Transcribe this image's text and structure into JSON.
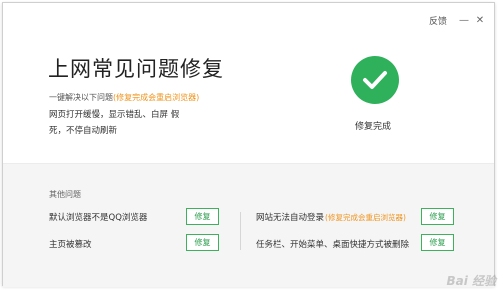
{
  "titlebar": {
    "feedback": "反馈",
    "minimize": "—",
    "close": "✕"
  },
  "main": {
    "title": "上网常见问题修复",
    "subtitle": "一键解决以下问题",
    "subtitle_hint": "(修复完成会重启浏览器)",
    "problems_text": "网页打开缓慢，显示错乱、白屏 假死，不停自动刷新",
    "status_label": "修复完成",
    "status_color": "#2fb15b"
  },
  "other": {
    "title": "其他问题",
    "items": [
      {
        "label": "默认浏览器不是QQ浏览器",
        "hint": "",
        "button": "修复"
      },
      {
        "label": "主页被篡改",
        "hint": "",
        "button": "修复"
      },
      {
        "label": "网站无法自动登录",
        "hint": "(修复完成会重启浏览器)",
        "button": "修复"
      },
      {
        "label": "任务栏、开始菜单、桌面快捷方式被删除",
        "hint": "",
        "button": "修复"
      }
    ]
  },
  "watermark": "Bai 经验",
  "accent": "#f0931b"
}
